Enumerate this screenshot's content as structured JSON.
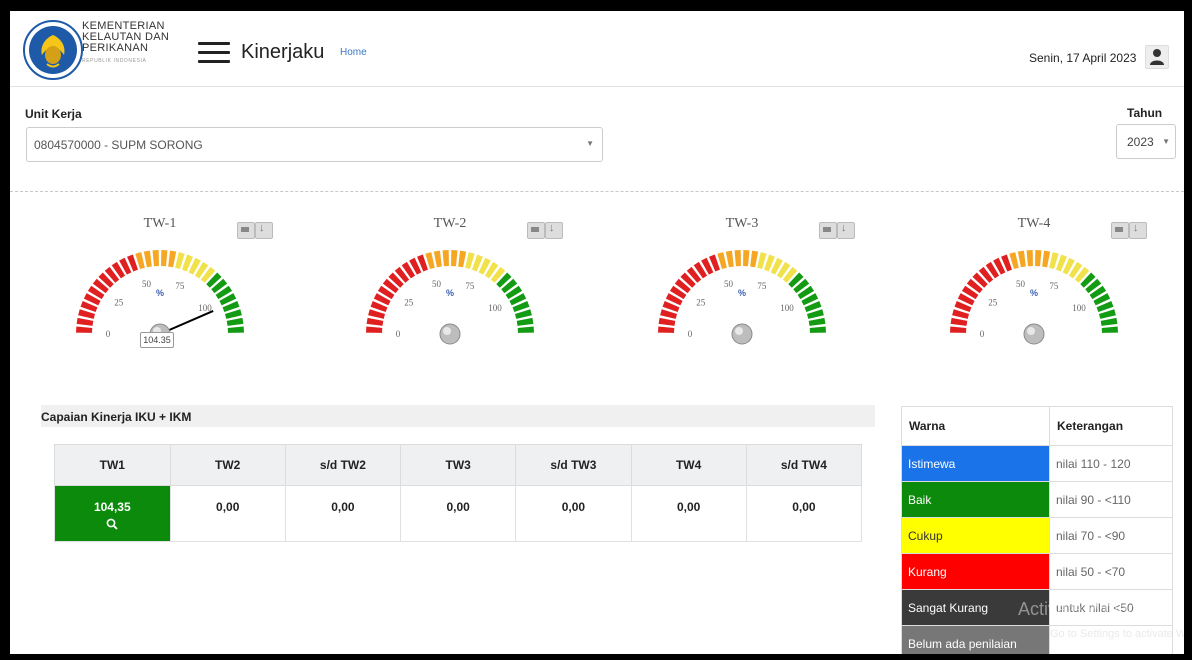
{
  "header": {
    "org_line1": "KEMENTERIAN",
    "org_line2": "KELAUTAN DAN",
    "org_line3": "PERIKANAN",
    "org_sub": "REPUBLIK INDONESIA",
    "app_title": "Kinerjaku",
    "home_link": "Home",
    "date": "Senin, 17 April 2023",
    "icons": {
      "menu": "hamburger-menu-icon",
      "user": "user-icon"
    }
  },
  "filters": {
    "unit_label": "Unit Kerja",
    "unit_value": "0804570000 - SUPM SORONG",
    "year_label": "Tahun",
    "year_value": "2023"
  },
  "gauges": [
    {
      "title": "TW-1",
      "value": 104.35,
      "value_label": "104.35",
      "ticks": [
        "0",
        "25",
        "50",
        "75",
        "100"
      ],
      "unit": "%"
    },
    {
      "title": "TW-2",
      "value": null,
      "ticks": [
        "0",
        "25",
        "50",
        "75",
        "100"
      ],
      "unit": "%"
    },
    {
      "title": "TW-3",
      "value": null,
      "ticks": [
        "0",
        "25",
        "50",
        "75",
        "100"
      ],
      "unit": "%"
    },
    {
      "title": "TW-4",
      "value": null,
      "ticks": [
        "0",
        "25",
        "50",
        "75",
        "100"
      ],
      "unit": "%"
    }
  ],
  "gauge_colors": {
    "red": "#e02020",
    "orange": "#f5a623",
    "yellow": "#f1e14a",
    "green": "#139b13"
  },
  "iku": {
    "title": "Capaian Kinerja IKU + IKM",
    "columns": [
      "TW1",
      "TW2",
      "s/d TW2",
      "TW3",
      "s/d TW3",
      "TW4",
      "s/d TW4"
    ],
    "row": [
      "104,35",
      "0,00",
      "0,00",
      "0,00",
      "0,00",
      "0,00",
      "0,00"
    ],
    "highlight_color": "#0b8a0b"
  },
  "legend": {
    "headers": [
      "Warna",
      "Keterangan"
    ],
    "rows": [
      {
        "label": "Istimewa",
        "desc": "nilai 110 - 120",
        "color": "#1a73e8"
      },
      {
        "label": "Baik",
        "desc": "nilai 90 - <110",
        "color": "#0b8a0b"
      },
      {
        "label": "Cukup",
        "desc": "nilai 70 - <90",
        "color": "#ffff00"
      },
      {
        "label": "Kurang",
        "desc": "nilai 50 - <70",
        "color": "#ff0000"
      },
      {
        "label": "Sangat Kurang",
        "desc": "untuk nilai <50",
        "color": "#3a3a3a"
      },
      {
        "label": "Belum ada penilaian",
        "desc": "",
        "color": "#777777"
      }
    ]
  },
  "watermark": {
    "line1": "Activate Windows",
    "line2": "Go to Settings to activate Windows."
  }
}
